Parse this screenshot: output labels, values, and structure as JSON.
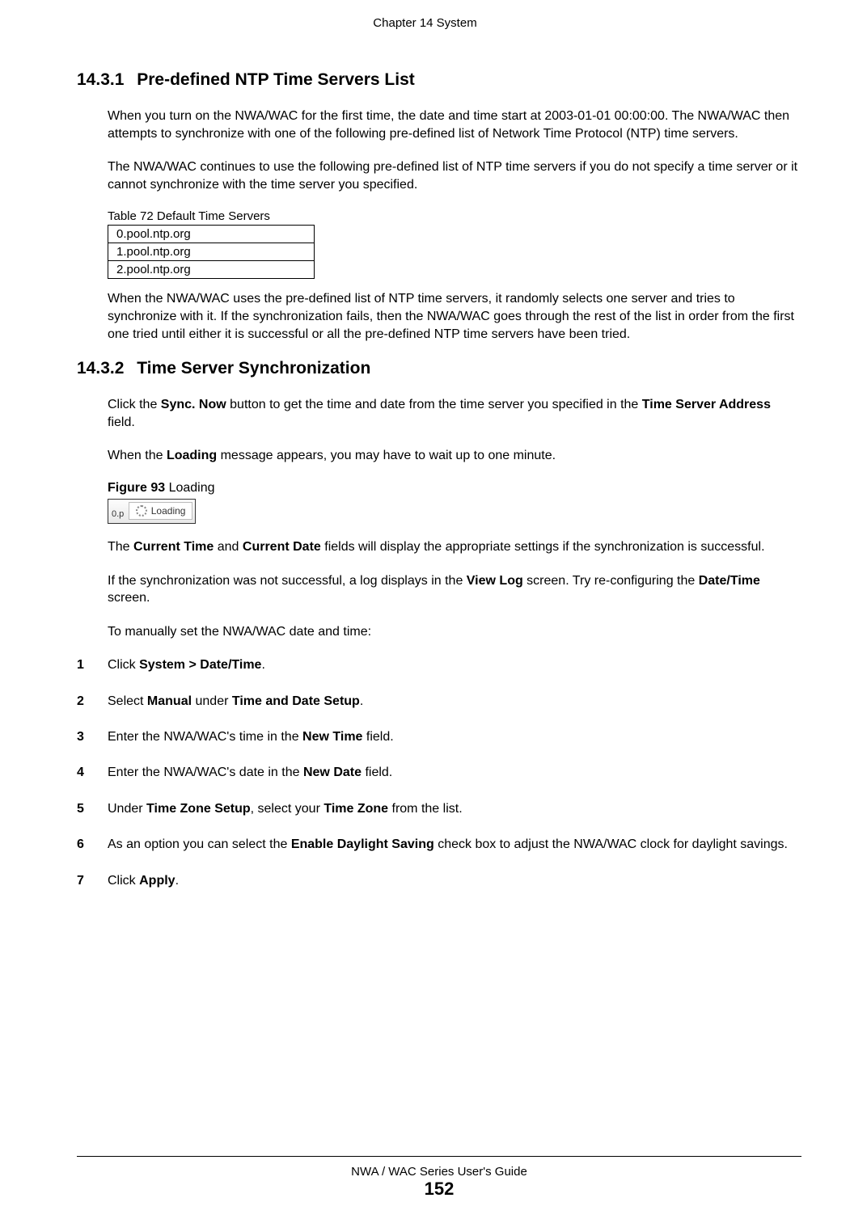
{
  "header": {
    "chapter": "Chapter 14 System"
  },
  "section_1": {
    "number": "14.3.1",
    "title": "Pre-defined NTP Time Servers List",
    "para1": "When you turn on the NWA/WAC for the first time, the date and time start at 2003-01-01 00:00:00. The NWA/WAC then attempts to synchronize with one of the following pre-defined list of Network Time Protocol (NTP) time servers.",
    "para2": "The NWA/WAC continues to use the following pre-defined list of NTP time servers if you do not specify a time server or it cannot synchronize with the time server you specified.",
    "table_caption": "Table 72   Default Time Servers",
    "table_rows": [
      "0.pool.ntp.org",
      "1.pool.ntp.org",
      "2.pool.ntp.org"
    ],
    "para3": "When the NWA/WAC uses the pre-defined list of NTP time servers, it randomly selects one server and tries to synchronize with it. If the synchronization fails, then the NWA/WAC goes through the rest of the list in order from the first one tried until either it is successful or all the pre-defined NTP time servers have been tried."
  },
  "section_2": {
    "number": "14.3.2",
    "title": "Time Server Synchronization",
    "para1_a": "Click the ",
    "para1_b": "Sync. Now",
    "para1_c": " button to get the time and date from the time server you specified in the ",
    "para1_d": "Time Server Address",
    "para1_e": " field.",
    "para2_a": "When the ",
    "para2_b": "Loading",
    "para2_c": " message appears, you may have to wait up to one minute.",
    "figure_label": "Figure 93",
    "figure_title": "   Loading",
    "loading_prefix": "0.p",
    "loading_text": "Loading",
    "para3_a": "The ",
    "para3_b": "Current Time",
    "para3_c": " and ",
    "para3_d": "Current Date",
    "para3_e": " fields will display the appropriate settings if the synchronization is successful.",
    "para4_a": "If the synchronization was not successful, a log displays in the ",
    "para4_b": "View Log",
    "para4_c": " screen. Try re-configuring the ",
    "para4_d": "Date/Time",
    "para4_e": " screen.",
    "para5": "To manually set the NWA/WAC date and time:",
    "steps": [
      {
        "n": "1",
        "a": "Click ",
        "b": "System > Date/Time",
        "c": "."
      },
      {
        "n": "2",
        "a": "Select ",
        "b": "Manual",
        "c": " under ",
        "d": "Time and Date Setup",
        "e": "."
      },
      {
        "n": "3",
        "a": "Enter the NWA/WAC's time in the ",
        "b": "New Time",
        "c": " field."
      },
      {
        "n": "4",
        "a": "Enter the NWA/WAC's date in the ",
        "b": "New Date",
        "c": " field."
      },
      {
        "n": "5",
        "a": "Under ",
        "b": "Time Zone Setup",
        "c": ", select your ",
        "d": "Time Zone",
        "e": " from the list."
      },
      {
        "n": "6",
        "a": "As an option you can select the ",
        "b": "Enable Daylight Saving",
        "c": " check box to adjust the NWA/WAC clock for daylight savings."
      },
      {
        "n": "7",
        "a": "Click ",
        "b": "Apply",
        "c": "."
      }
    ]
  },
  "footer": {
    "title": "NWA / WAC Series User's Guide",
    "page": "152"
  }
}
